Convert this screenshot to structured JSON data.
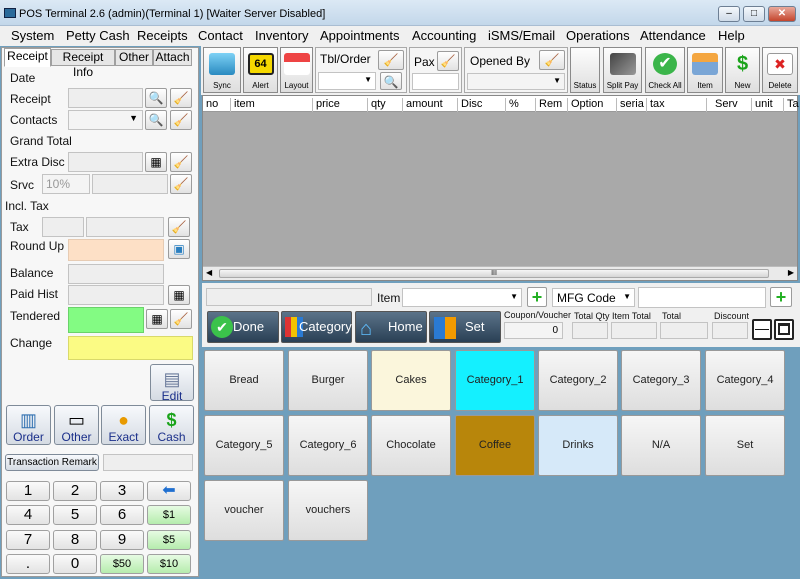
{
  "window": {
    "title": "POS Terminal 2.6 (admin)(Terminal 1) [Waiter Server Disabled]"
  },
  "menu": [
    "System",
    "Petty Cash",
    "Receipts",
    "Contact",
    "Inventory",
    "Appointments",
    "Accounting",
    "iSMS/Email",
    "Operations",
    "Attendance",
    "Help"
  ],
  "left": {
    "tabs": [
      "Receipt",
      "Receipt Info",
      "Other",
      "Attach"
    ],
    "labels": {
      "date": "Date",
      "receipt": "Receipt",
      "contacts": "Contacts",
      "grand_total": "Grand Total",
      "extra_disc": "Extra Disc",
      "srvc": "Srvc",
      "incl_tax": "Incl. Tax",
      "tax": "Tax",
      "round_up": "Round Up",
      "balance": "Balance",
      "paid_hist": "Paid Hist",
      "tendered": "Tendered",
      "change": "Change"
    },
    "srvc_placeholder": "10%",
    "edit_label": "Edit",
    "actions": [
      "Order",
      "Other",
      "Exact",
      "Cash"
    ],
    "transaction_remark": "Transaction Remark",
    "keypad": [
      "1",
      "2",
      "3",
      "4",
      "5",
      "6",
      "7",
      "8",
      "9",
      ".",
      "0"
    ],
    "quick_cash": [
      "$1",
      "$5",
      "$50",
      "$10"
    ]
  },
  "toolbar": {
    "sync": "Sync",
    "alert": "Alert",
    "alert_count": "64",
    "layout": "Layout",
    "tbl_order": "Tbl/Order",
    "pax": "Pax",
    "opened_by": "Opened By",
    "status": "Status",
    "split_pay": "Split Pay",
    "check_all": "Check All",
    "item": "Item",
    "new": "New",
    "delete": "Delete"
  },
  "grid": {
    "columns": [
      "no",
      "item",
      "price",
      "qty",
      "amount",
      "Disc",
      "%",
      "Rem",
      "Option",
      "seria",
      "tax",
      "Serv",
      "unit",
      "Ta"
    ],
    "scroll_glyph": "III"
  },
  "itembar": {
    "item_label": "Item",
    "mfg_code": "MFG Code",
    "coupon_label": "Coupon/Voucher",
    "coupon_value": "0",
    "total_qty": "Total Qty",
    "item_total": "Item Total",
    "total": "Total",
    "discount": "Discount"
  },
  "nav": {
    "done": "Done",
    "category": "Category",
    "home": "Home",
    "set": "Set"
  },
  "categories": [
    {
      "label": "Bread",
      "color": "#e3e3e3"
    },
    {
      "label": "Burger",
      "color": "#e3e3e3"
    },
    {
      "label": "Cakes",
      "color": "#fbf6dc"
    },
    {
      "label": "Category_1",
      "color": "#14f0ff"
    },
    {
      "label": "Category_2",
      "color": "#e3e3e3"
    },
    {
      "label": "Category_3",
      "color": "#e3e3e3"
    },
    {
      "label": "Category_4",
      "color": "#e3e3e3"
    },
    {
      "label": "Category_5",
      "color": "#e3e3e3"
    },
    {
      "label": "Category_6",
      "color": "#e3e3e3"
    },
    {
      "label": "Chocolate",
      "color": "#e3e3e3"
    },
    {
      "label": "Coffee",
      "color": "#b8860b"
    },
    {
      "label": "Drinks",
      "color": "#d6e9f9"
    },
    {
      "label": "N/A",
      "color": "#e3e3e3"
    },
    {
      "label": "Set",
      "color": "#e3e3e3"
    },
    {
      "label": "voucher",
      "color": "#e3e3e3"
    },
    {
      "label": "vouchers",
      "color": "#e3e3e3"
    }
  ]
}
